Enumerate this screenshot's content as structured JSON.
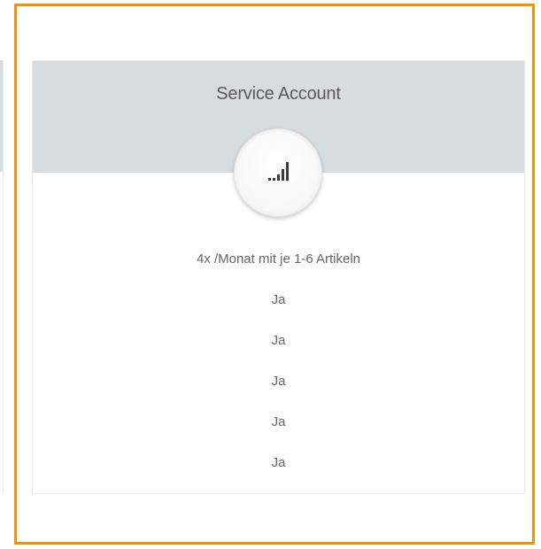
{
  "plan": {
    "title": "Service Account",
    "icon": "signal-bars-icon",
    "features": [
      "4x /Monat mit je 1-6 Artikeln",
      "Ja",
      "Ja",
      "Ja",
      "Ja",
      "Ja"
    ]
  },
  "colors": {
    "highlight_border": "#f0930f",
    "header_background": "#d7dcdf",
    "text": "#666666"
  }
}
